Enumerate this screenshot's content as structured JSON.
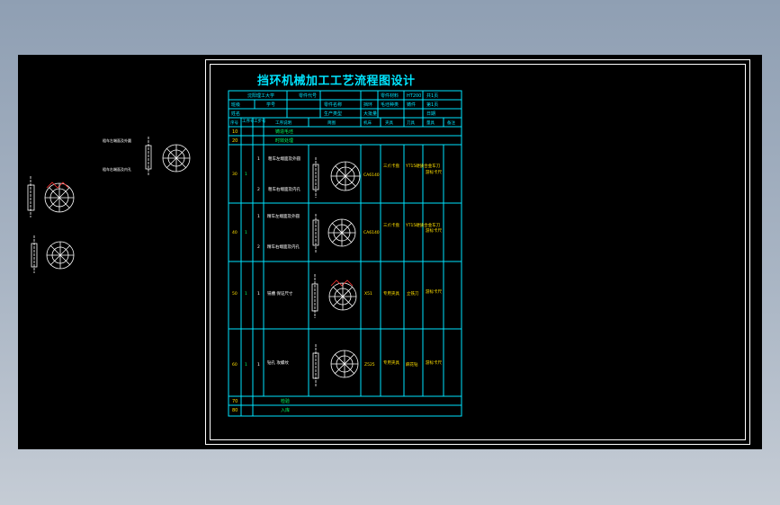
{
  "drawing": {
    "title": "挡环机械加工工艺流程图设计"
  },
  "table": {
    "header_row1": [
      "沈阳理工大学",
      "零件代号",
      "零件材料",
      "HT200",
      "共1页"
    ],
    "header_row2": [
      "班级",
      "学号",
      "零件名称",
      "挡环",
      "毛坯种类",
      "铸件",
      "第1页"
    ],
    "header_row3": [
      "姓名",
      "生产类型",
      "大批量",
      "日期"
    ],
    "columns": [
      "序号",
      "工序号",
      "工步号",
      "工序说明",
      "简图",
      "机床",
      "夹具",
      "刀具",
      "量具",
      "备注"
    ],
    "rows": [
      {
        "no": "10",
        "text": "铸造毛坯"
      },
      {
        "no": "20",
        "text": "时效处理"
      },
      {
        "no": "30",
        "step1": "粗车左端面及外圆",
        "step2": "粗车右端面及内孔",
        "machine": "CA6140",
        "fixture": "三爪卡盘",
        "tool": "YT15硬质合金车刀",
        "gauge": "游标卡尺"
      },
      {
        "no": "40",
        "step1": "精车左端面及外圆",
        "step2": "精车右端面及内孔",
        "machine": "CA6140",
        "fixture": "三爪卡盘",
        "tool": "YT15硬质合金车刀",
        "gauge": "游标卡尺"
      },
      {
        "no": "50",
        "step1": "铣槽 保证尺寸",
        "machine": "X51",
        "fixture": "专用夹具",
        "tool": "立铣刀",
        "gauge": "游标卡尺"
      },
      {
        "no": "60",
        "step1": "钻孔 攻螺纹",
        "machine": "Z525",
        "fixture": "专用夹具",
        "tool": "麻花钻",
        "gauge": "游标卡尺"
      },
      {
        "no": "70",
        "text": "检验"
      },
      {
        "no": "80",
        "text": "入库"
      }
    ]
  },
  "side_notes": [
    "粗车左端面及外圆",
    "粗车右端面及内孔"
  ]
}
